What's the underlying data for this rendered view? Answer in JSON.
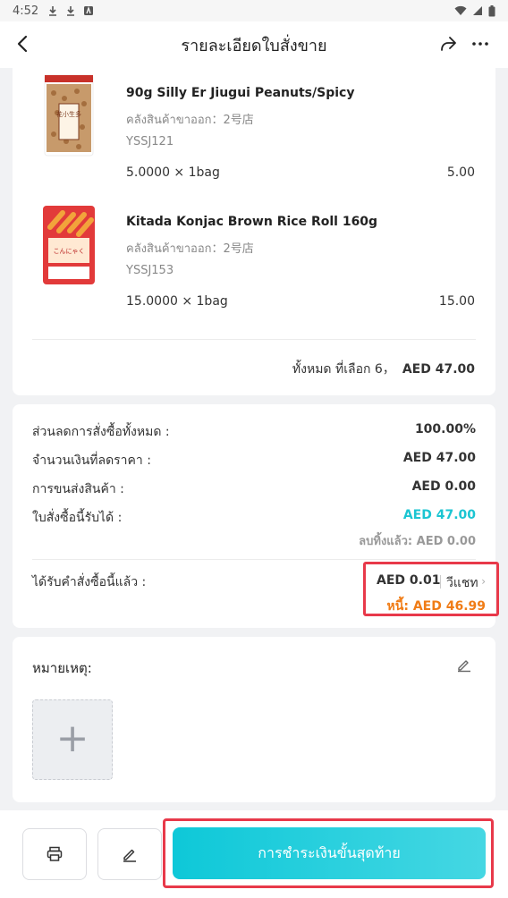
{
  "status_bar": {
    "time": "4:52"
  },
  "header": {
    "title": "รายละเอียดใบสั่งขาย"
  },
  "items": [
    {
      "name": "90g Silly Er Jiugui Peanuts/Spicy",
      "warehouse": "คลังสินค้าขาออก：2号店",
      "code": "YSSJ121",
      "qty": "5.0000 × 1bag",
      "amount": "5.00",
      "thumb_text": "花小生多"
    },
    {
      "name": "Kitada Konjac Brown Rice Roll 160g",
      "warehouse": "คลังสินค้าขาออก：2号店",
      "code": "YSSJ153",
      "qty": "15.0000 × 1bag",
      "amount": "15.00",
      "thumb_text": "こんにゃく"
    }
  ],
  "items_total": {
    "label": "ทั้งหมด ที่เลือก 6，",
    "value": "AED 47.00"
  },
  "summary": {
    "discount_label": "ส่วนลดการสั่งซื้อทั้งหมด :",
    "discount_value": "100.00%",
    "discounted_amount_label": "จำนวนเงินที่ลดราคา :",
    "discounted_amount_value": "AED 47.00",
    "shipping_label": "การขนส่งสินค้า :",
    "shipping_value": "AED 0.00",
    "receivable_label": "ใบสั่งซื้อนี้รับได้ :",
    "receivable_value": "AED 47.00",
    "writeoff_text": "ลบทิ้งแล้ว: AED 0.00",
    "received_label": "ได้รับคำสั่งซื้อนี้แล้ว :",
    "received_value": "AED 0.01",
    "received_method": "วีแชท",
    "debt_text": "หนี้: AED 46.99"
  },
  "notes": {
    "label": "หมายเหตุ:"
  },
  "footer": {
    "final_payment_label": "การชำระเงินขั้นสุดท้าย"
  },
  "colors": {
    "accent_teal": "#1bc5d2",
    "debt_orange": "#f07c16",
    "highlight_red": "#e8394a"
  }
}
